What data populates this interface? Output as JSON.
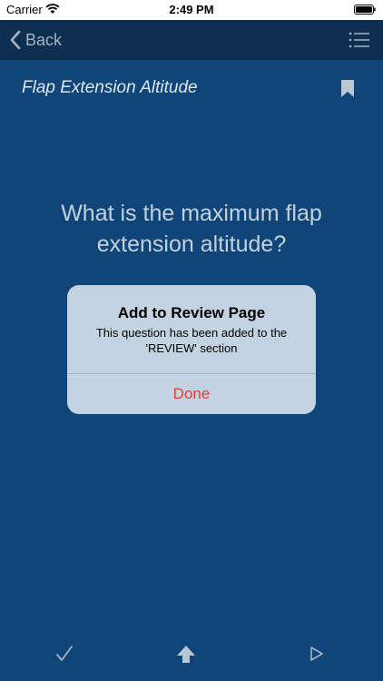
{
  "status_bar": {
    "carrier": "Carrier",
    "time": "2:49 PM"
  },
  "nav": {
    "back_label": "Back",
    "menu_icon": "list-icon"
  },
  "question": {
    "title": "Flap Extension Altitude",
    "text": "What is the maximum flap extension altitude?"
  },
  "alert": {
    "title": "Add to Review Page",
    "message": "This question has been added to the 'REVIEW' section",
    "button": "Done"
  },
  "toolbar": {
    "icons": [
      "check-icon",
      "up-arrow-icon",
      "play-icon"
    ]
  },
  "colors": {
    "background": "#0f4579",
    "nav_bar": "#0c2f52",
    "alert_bg": "#c4d3e1",
    "done": "#e53c31"
  }
}
